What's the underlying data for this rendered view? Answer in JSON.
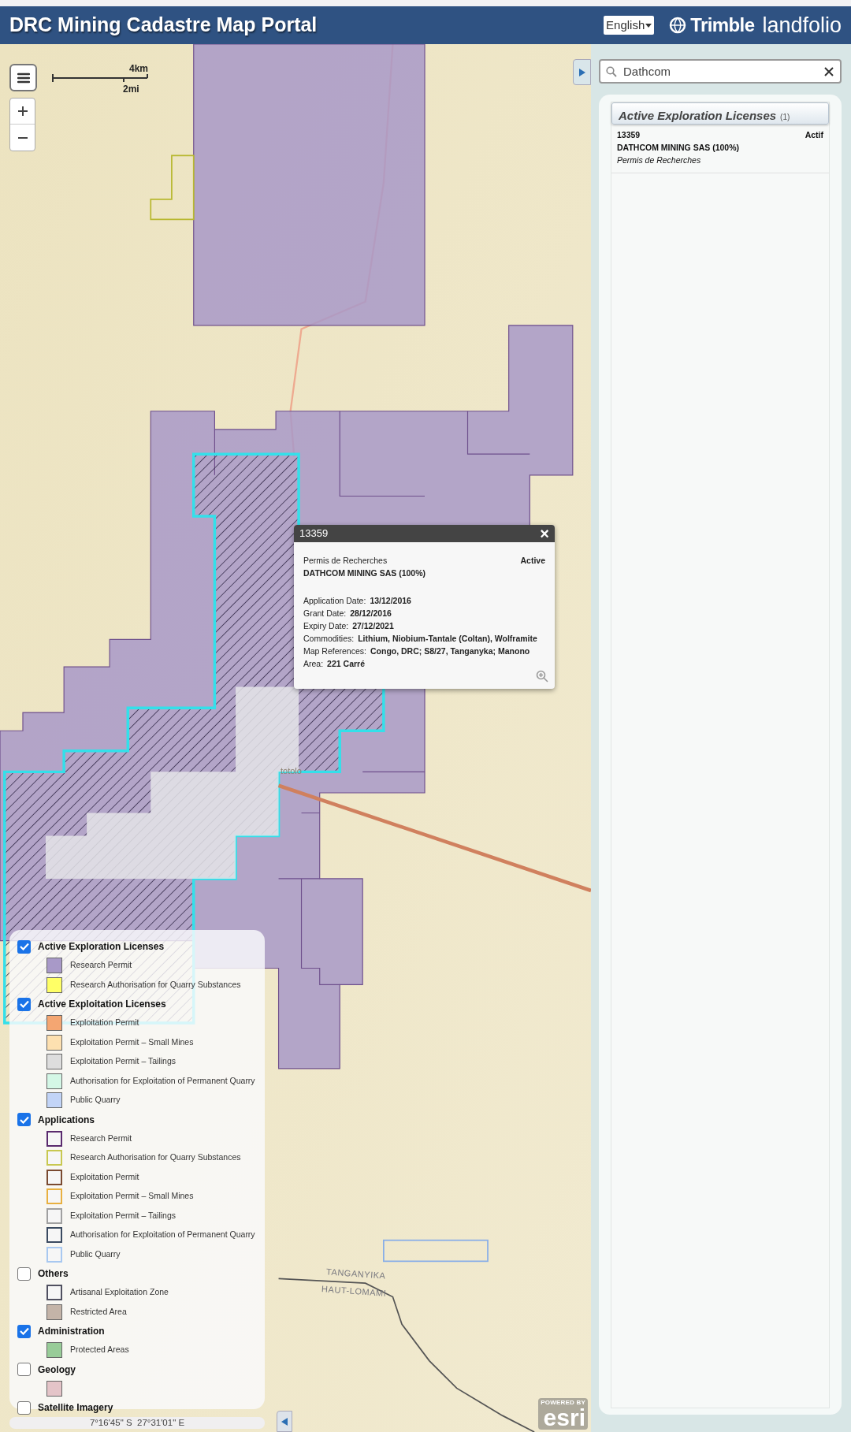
{
  "header": {
    "title": "DRC Mining Cadastre Map Portal",
    "language": "English",
    "brand": {
      "name": "Trimble",
      "product": "landfolio"
    }
  },
  "map": {
    "scale": {
      "km": "4km",
      "mi": "2mi"
    },
    "labels": [
      {
        "text": "totolo",
        "kind": "place"
      },
      {
        "text": "TANGANYIKA",
        "kind": "region"
      },
      {
        "text": "HAUT-LOMAMI",
        "kind": "region"
      }
    ],
    "attribution": {
      "powered_by": "POWERED BY",
      "brand": "esri"
    },
    "coordinates": "7°16'45\" S  27°31'01\" E"
  },
  "popup": {
    "title": "13359",
    "close": "×",
    "type": "Permis de Recherches",
    "status": "Active",
    "holder": "DATHCOM MINING SAS (100%)",
    "fields": [
      {
        "label": "Application Date:",
        "value": "13/12/2016"
      },
      {
        "label": "Grant Date:",
        "value": "28/12/2016"
      },
      {
        "label": "Expiry Date:",
        "value": "27/12/2021"
      },
      {
        "label": "Commodities:",
        "value": "Lithium, Niobium-Tantale (Coltan), Wolframite"
      },
      {
        "label": "Map References:",
        "value": "Congo, DRC; S8/27, Tanganyka; Manono"
      },
      {
        "label": "Area:",
        "value": "221 Carré"
      }
    ]
  },
  "search": {
    "value": "Dathcom"
  },
  "results": {
    "title": "Active Exploration Licenses",
    "count": "(1)",
    "items": [
      {
        "id": "13359",
        "status": "Actif",
        "holder": "DATHCOM MINING SAS (100%)",
        "type": "Permis de Recherches"
      }
    ]
  },
  "legend": [
    {
      "label": "Active Exploration Licenses",
      "checked": true,
      "items": [
        {
          "label": "Research Permit",
          "kind": "fill",
          "color": "#a899c8"
        },
        {
          "label": "Research Authorisation for Quarry Substances",
          "kind": "fill",
          "color": "#ffff66"
        }
      ]
    },
    {
      "label": "Active Exploitation Licenses",
      "checked": true,
      "items": [
        {
          "label": "Exploitation Permit",
          "kind": "fill",
          "color": "#f4a672"
        },
        {
          "label": "Exploitation Permit – Small Mines",
          "kind": "fill",
          "color": "#fde0b0"
        },
        {
          "label": "Exploitation Permit – Tailings",
          "kind": "fill",
          "color": "#dddddd"
        },
        {
          "label": "Authorisation for Exploitation of Permanent Quarry",
          "kind": "fill",
          "color": "#d4f7e6"
        },
        {
          "label": "Public Quarry",
          "kind": "fill",
          "color": "#c2d4f7"
        }
      ]
    },
    {
      "label": "Applications",
      "checked": true,
      "items": [
        {
          "label": "Research Permit",
          "kind": "outline",
          "color": "#5a2a6e"
        },
        {
          "label": "Research Authorisation for Quarry Substances",
          "kind": "outline",
          "color": "#c8c850"
        },
        {
          "label": "Exploitation Permit",
          "kind": "outline",
          "color": "#7a4a30"
        },
        {
          "label": "Exploitation Permit – Small Mines",
          "kind": "outline",
          "color": "#e8b040"
        },
        {
          "label": "Exploitation Permit – Tailings",
          "kind": "outline",
          "color": "#a0a0a0"
        },
        {
          "label": "Authorisation for Exploitation of Permanent Quarry",
          "kind": "outline",
          "color": "#3a4a60"
        },
        {
          "label": "Public Quarry",
          "kind": "outline",
          "color": "#a8c8f0"
        }
      ]
    },
    {
      "label": "Others",
      "checked": false,
      "items": [
        {
          "label": "Artisanal Exploitation Zone",
          "kind": "outline",
          "color": "#505060"
        },
        {
          "label": "Restricted Area",
          "kind": "fill",
          "color": "#c4b4a8"
        }
      ]
    },
    {
      "label": "Administration",
      "checked": true,
      "items": [
        {
          "label": "Protected Areas",
          "kind": "fill",
          "color": "#98cc98"
        }
      ]
    },
    {
      "label": "Geology",
      "checked": false,
      "items": [
        {
          "kind": "fill",
          "color": "#e4c4c8"
        }
      ]
    },
    {
      "label": "Satellite Imagery",
      "checked": false
    }
  ]
}
